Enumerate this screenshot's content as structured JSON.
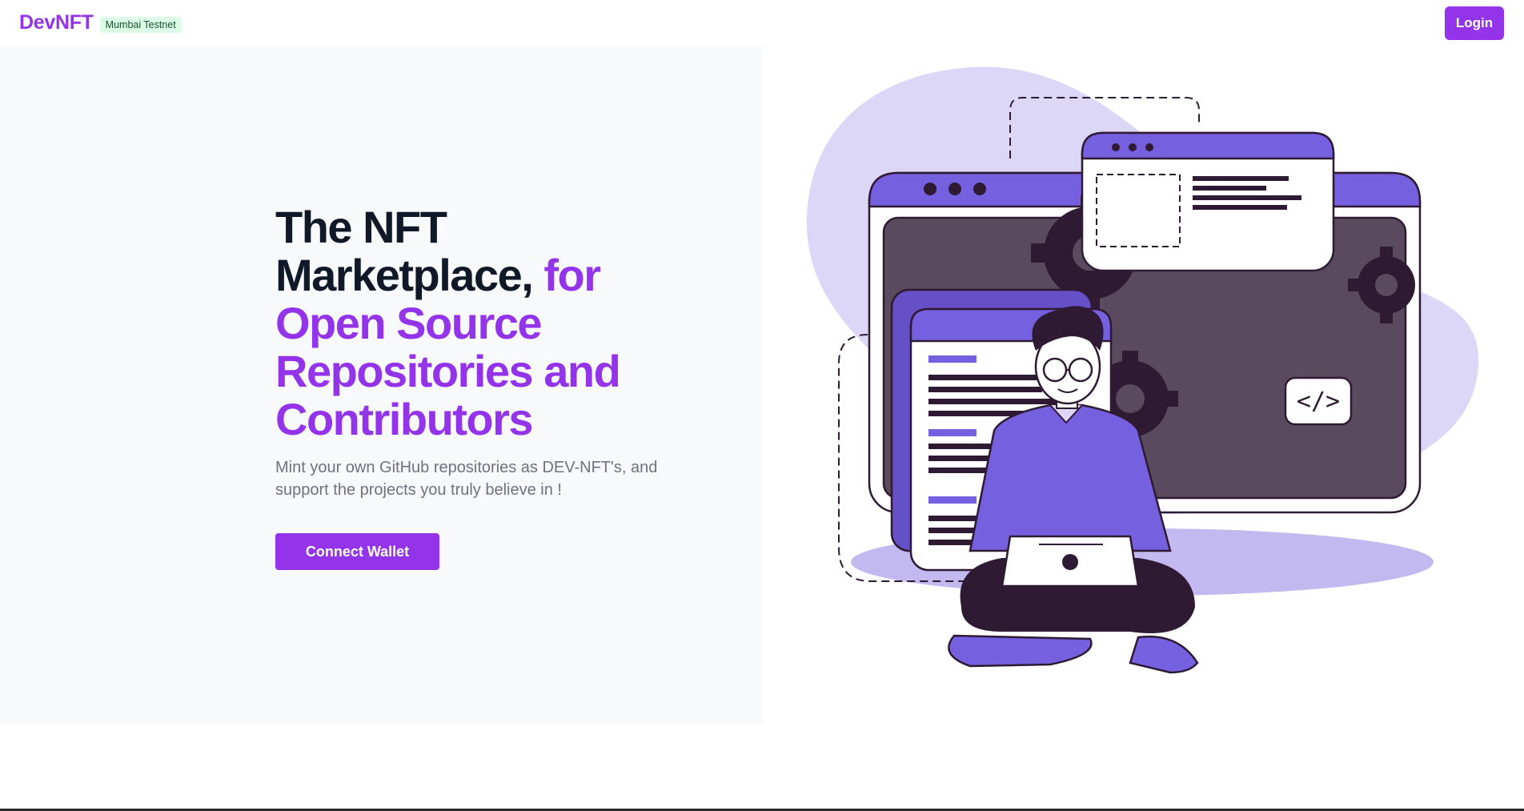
{
  "header": {
    "brand": "DevNFT",
    "network_badge": "Mumbai Testnet",
    "login_label": "Login"
  },
  "hero": {
    "title_dark": "The NFT Marketplace, ",
    "title_accent": "for Open Source Repositories and Contributors",
    "subtitle": "Mint your own GitHub repositories as DEV-NFT's, and support the projects you truly believe in !",
    "connect_label": "Connect Wallet"
  },
  "illustration": {
    "code_badge": "</>",
    "icons": [
      "browser-window-icon",
      "gear-icon",
      "document-icon",
      "developer-with-laptop"
    ]
  },
  "colors": {
    "brand": "#9333ea",
    "badge_bg": "#dcfce7",
    "badge_text": "#14532d",
    "hero_bg": "#f8f9fb",
    "illustration_purple": "#7560df",
    "illustration_lavender": "#dcd7f6",
    "illustration_dark": "#2e1a33"
  }
}
